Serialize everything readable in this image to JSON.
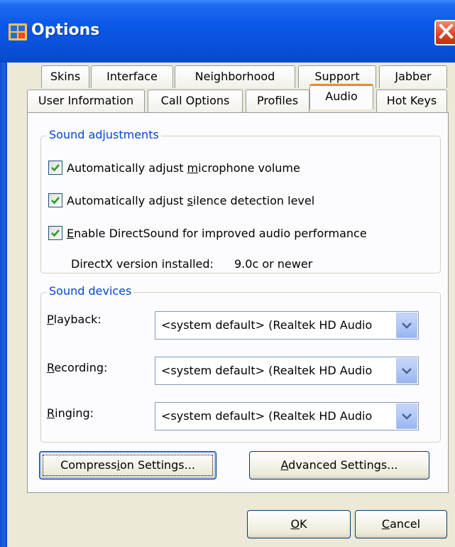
{
  "window": {
    "title": "Options",
    "close_glyph": "✕"
  },
  "tabs_row1": [
    "Skins",
    "Interface",
    "Neighborhood",
    "Support",
    "Jabber"
  ],
  "tabs_row2": [
    "User Information",
    "Call Options",
    "Profiles",
    "Audio",
    "Hot Keys"
  ],
  "active_tab": "Audio",
  "sound_adjustments": {
    "title": "Sound adjustments",
    "items": [
      {
        "label_pre": "Automatically adjust ",
        "mnemonic": "m",
        "label_post": "icrophone volume",
        "checked": true
      },
      {
        "label_pre": "Automatically adjust ",
        "mnemonic": "s",
        "label_post": "ilence detection level",
        "checked": true
      },
      {
        "label_pre": "",
        "mnemonic": "E",
        "label_post": "nable DirectSound for improved audio performance",
        "checked": true
      }
    ],
    "directx_label": "DirectX version installed:",
    "directx_value": "9.0c or newer"
  },
  "sound_devices": {
    "title": "Sound devices",
    "playback": {
      "mnemonic": "P",
      "rest": "layback:",
      "value": "<system default> (Realtek HD Audio"
    },
    "recording": {
      "mnemonic": "R",
      "rest": "ecording:",
      "value": "<system default> (Realtek HD Audio"
    },
    "ringing": {
      "mnemonic": "R",
      "rest": "inging:",
      "value": "<system default> (Realtek HD Audio"
    }
  },
  "buttons": {
    "compression": {
      "pre": "Compress",
      "mnemonic": "i",
      "post": "on Settings..."
    },
    "advanced": {
      "pre": "",
      "mnemonic": "A",
      "post": "dvanced Settings..."
    },
    "ok": {
      "pre": "",
      "mnemonic": "O",
      "post": "K"
    },
    "cancel": {
      "pre": "",
      "mnemonic": "C",
      "post": "ancel"
    }
  },
  "colors": {
    "title_bar": "#0a58e8",
    "group_title": "#0046d5",
    "dialog_bg": "#ece9d8"
  }
}
